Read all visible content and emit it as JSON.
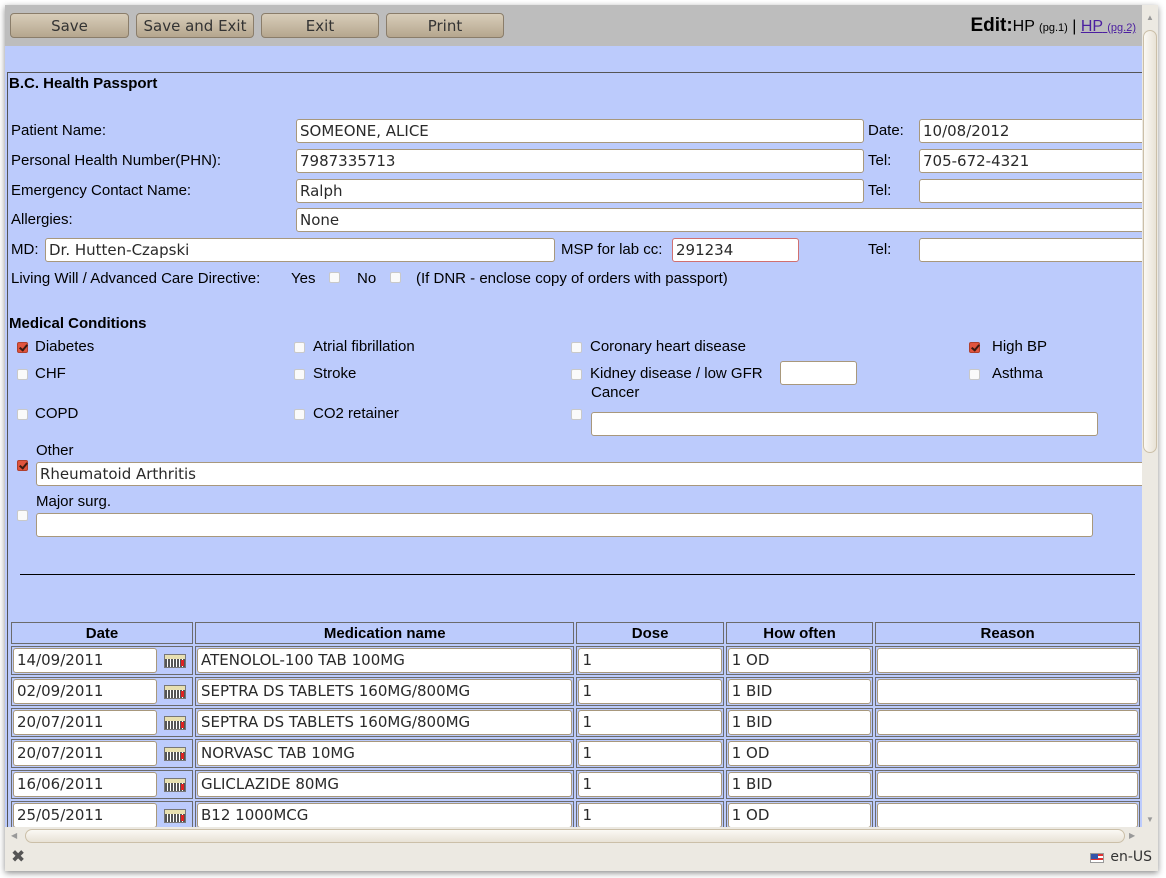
{
  "toolbar": {
    "buttons": [
      "Save",
      "Save and Exit",
      "Exit",
      "Print"
    ],
    "title_prefix": "Edit:",
    "title_form": "HP",
    "title_page": "(pg.1)",
    "separator": "|",
    "link_form": "HP",
    "link_page": "(pg.2)"
  },
  "form": {
    "heading": "B.C. Health Passport",
    "patient_name": {
      "label": "Patient Name:",
      "value": "SOMEONE, ALICE"
    },
    "date": {
      "label": "Date:",
      "value": "10/08/2012"
    },
    "phn": {
      "label": "Personal Health Number(PHN):",
      "value": "7987335713"
    },
    "phn_tel": {
      "label": "Tel:",
      "value": "705-672-4321"
    },
    "emergency_contact": {
      "label": "Emergency Contact Name:",
      "value": "Ralph"
    },
    "emergency_tel": {
      "label": "Tel:",
      "value": ""
    },
    "allergies": {
      "label": "Allergies:",
      "value": "None"
    },
    "md": {
      "label": "MD:",
      "value": "Dr. Hutten-Czapski"
    },
    "msp": {
      "label": "MSP for lab cc:",
      "value": "291234"
    },
    "md_tel": {
      "label": "Tel:",
      "value": ""
    },
    "living_will": {
      "label": "Living Will / Advanced Care Directive:",
      "yes_label": "Yes",
      "yes_checked": false,
      "no_label": "No",
      "no_checked": false,
      "note": "(If DNR - enclose copy of orders with passport)"
    }
  },
  "conditions": {
    "heading": "Medical Conditions",
    "items": [
      {
        "label": "Diabetes",
        "checked": true
      },
      {
        "label": "Atrial fibrillation",
        "checked": false
      },
      {
        "label": "Coronary heart disease",
        "checked": false
      },
      {
        "label": "High BP",
        "checked": true
      },
      {
        "label": "CHF",
        "checked": false
      },
      {
        "label": "Stroke",
        "checked": false
      },
      {
        "label": "Kidney disease / low GFR",
        "checked": false,
        "value": ""
      },
      {
        "label": "Asthma",
        "checked": false
      },
      {
        "label": "COPD",
        "checked": false
      },
      {
        "label": "CO2 retainer",
        "checked": false
      },
      {
        "label": "Cancer",
        "checked": false,
        "value": ""
      },
      {
        "label": "Other",
        "checked": true,
        "value": "Rheumatoid Arthritis"
      },
      {
        "label": "Major surg.",
        "checked": false,
        "value": ""
      }
    ]
  },
  "medications": {
    "columns": [
      "Date",
      "Medication name",
      "Dose",
      "How often",
      "Reason"
    ],
    "rows": [
      {
        "date": "14/09/2011",
        "name": "ATENOLOL-100 TAB 100MG",
        "dose": "1",
        "often": "1 OD",
        "reason": ""
      },
      {
        "date": "02/09/2011",
        "name": "SEPTRA DS TABLETS 160MG/800MG",
        "dose": "1",
        "often": "1 BID",
        "reason": ""
      },
      {
        "date": "20/07/2011",
        "name": "SEPTRA DS TABLETS 160MG/800MG",
        "dose": "1",
        "often": "1 BID",
        "reason": ""
      },
      {
        "date": "20/07/2011",
        "name": "NORVASC TAB 10MG",
        "dose": "1",
        "often": "1 OD",
        "reason": ""
      },
      {
        "date": "16/06/2011",
        "name": "GLICLAZIDE 80MG",
        "dose": "1",
        "often": "1 BID",
        "reason": ""
      },
      {
        "date": "25/05/2011",
        "name": "B12 1000MCG",
        "dose": "1",
        "often": "1 OD",
        "reason": ""
      },
      {
        "date": "",
        "name": "",
        "dose": "",
        "often": "",
        "reason": ""
      }
    ]
  },
  "statusbar": {
    "close_icon": "close-x-icon",
    "locale": "en-US"
  }
}
